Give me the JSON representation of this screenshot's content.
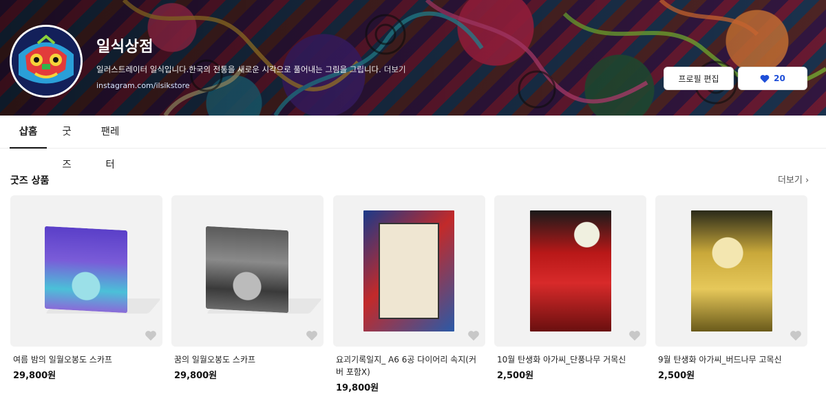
{
  "header": {
    "store_name": "일식상점",
    "description": "일러스트레이터 일식입니다.한국의 전통을 새로운 시각으로 풀어내는 그림을 그립니다.",
    "description_more": "더보기",
    "link": "instagram.com/ilsikstore",
    "edit_button": "프로필 편집",
    "like_count": "20"
  },
  "tabs": [
    {
      "label": "샵홈",
      "active": true
    },
    {
      "label": "굿즈",
      "active": false
    },
    {
      "label": "팬레터",
      "active": false
    }
  ],
  "section": {
    "title": "굿즈 상품",
    "more_label": "더보기 ›"
  },
  "products": [
    {
      "name": "여름 밤의 일월오봉도 스카프",
      "price": "29,800원"
    },
    {
      "name": "꿈의 일월오봉도 스카프",
      "price": "29,800원"
    },
    {
      "name": "요괴기록일지_ A6 6공 다이어리 속지(커버 포함X)",
      "price": "19,800원"
    },
    {
      "name": "10월 탄생화 아가씨_단풍나무 거목신",
      "price": "2,500원"
    },
    {
      "name": "9월 탄생화 아가씨_버드나무 고목신",
      "price": "2,500원"
    }
  ],
  "colors": {
    "like_accent": "#1f4fd8",
    "thumb_bg": "#f2f2f2"
  }
}
